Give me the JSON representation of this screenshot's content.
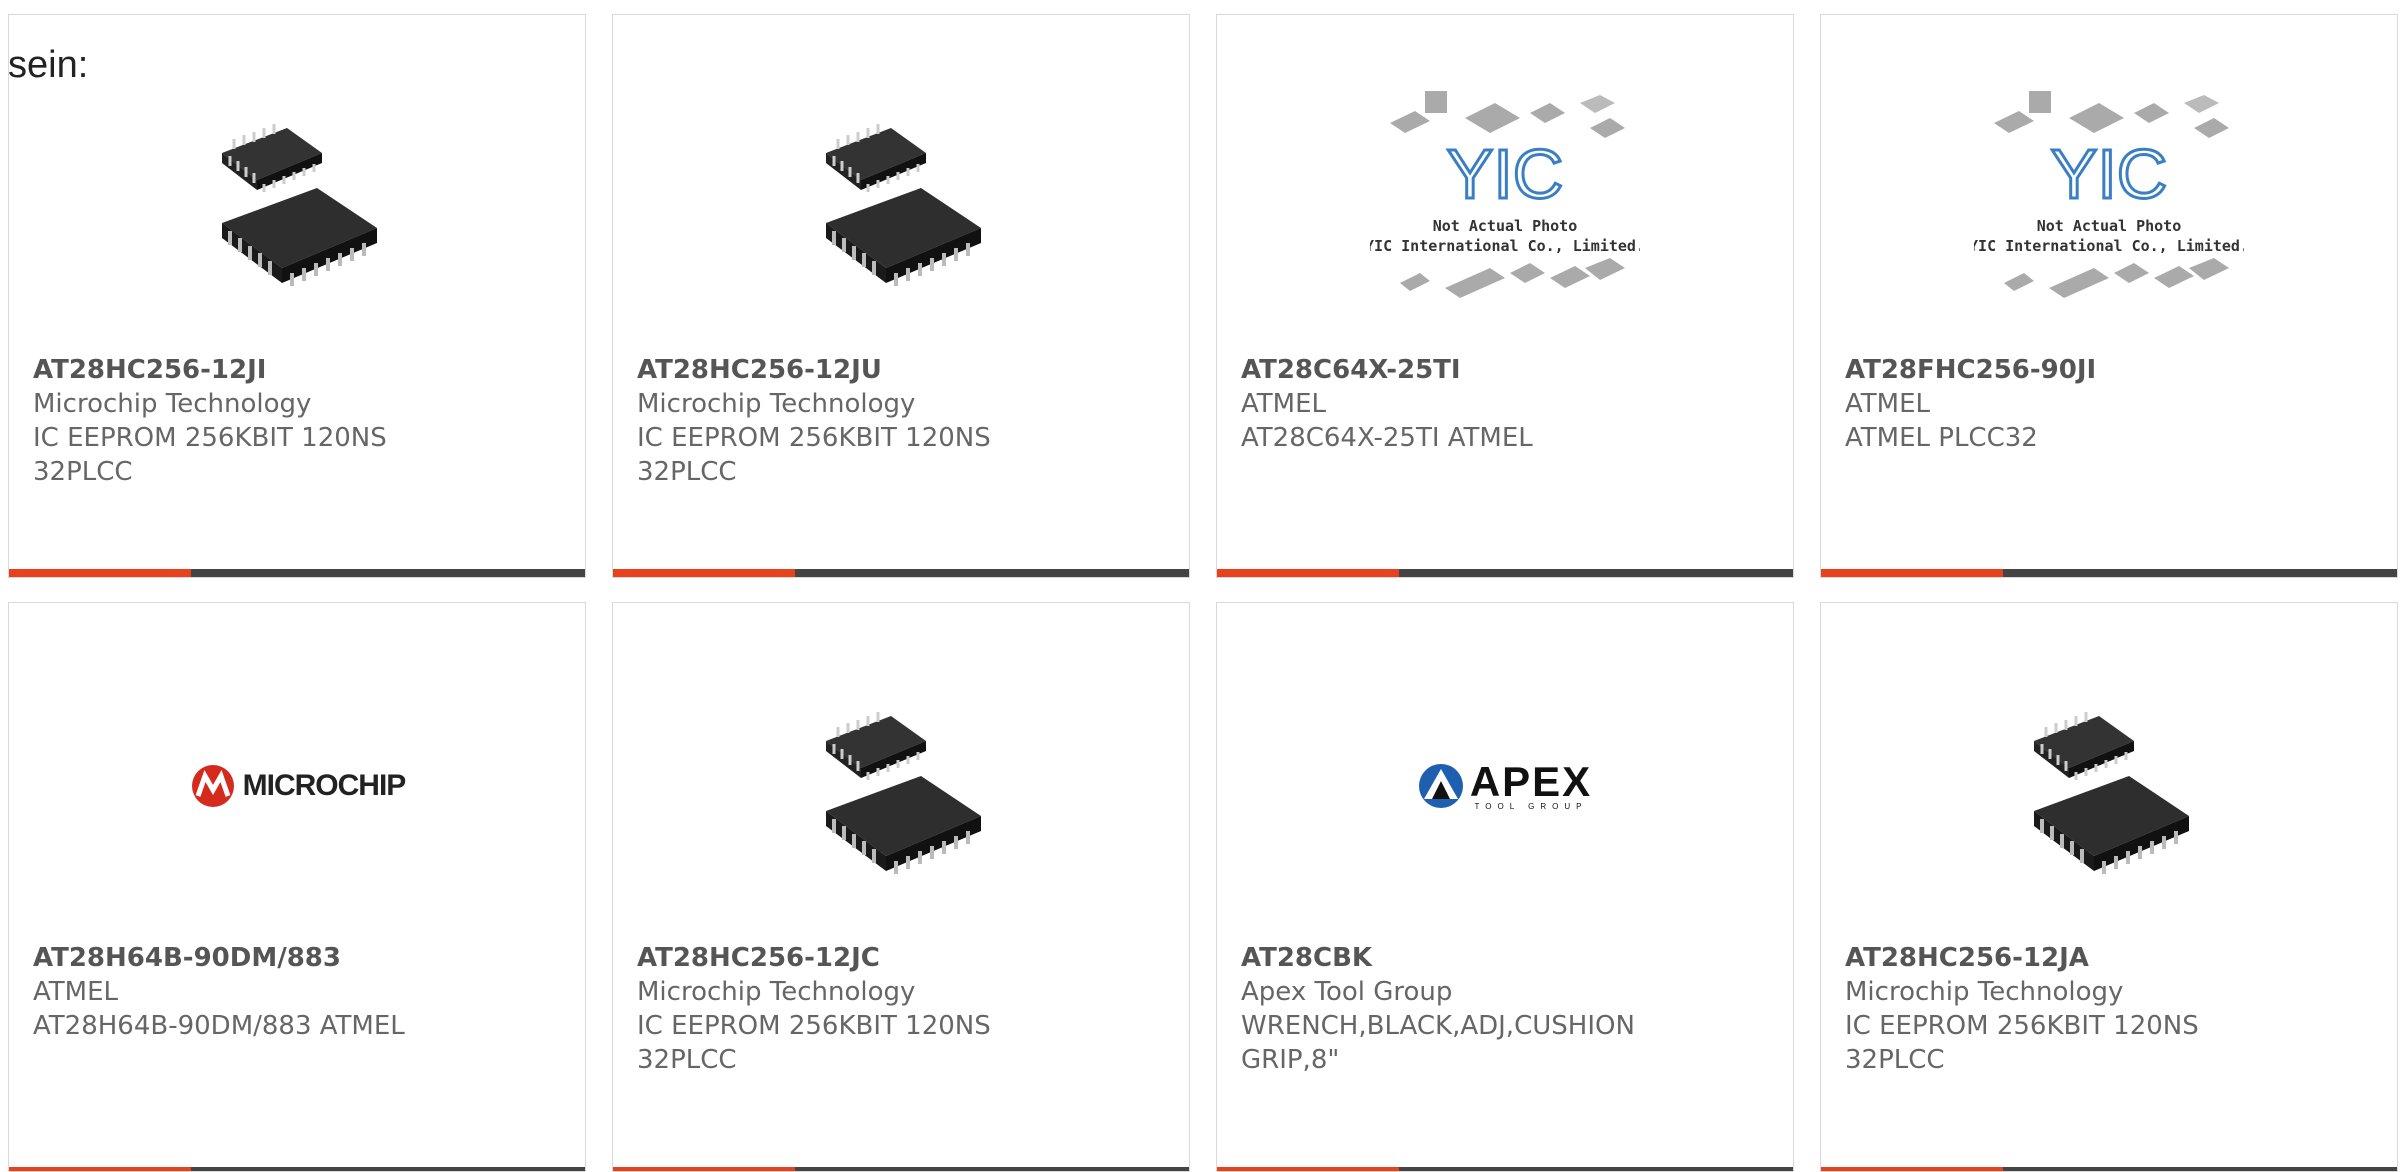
{
  "intro_text": "sein:",
  "products": [
    {
      "part": "AT28HC256-12JI",
      "maker": "Microchip Technology",
      "desc": "IC EEPROM 256KBIT 120NS 32PLCC",
      "image": "plcc-chip"
    },
    {
      "part": "AT28HC256-12JU",
      "maker": "Microchip Technology",
      "desc": "IC EEPROM 256KBIT 120NS 32PLCC",
      "image": "plcc-chip"
    },
    {
      "part": "AT28C64X-25TI",
      "maker": "ATMEL",
      "desc": "AT28C64X-25TI ATMEL",
      "image": "yic-placeholder",
      "placeholder_lines": [
        "Not Actual Photo",
        "YIC International Co., Limited."
      ],
      "logo": "YIC"
    },
    {
      "part": "AT28FHC256-90JI",
      "maker": "ATMEL",
      "desc": "ATMEL PLCC32",
      "image": "yic-placeholder",
      "placeholder_lines": [
        "Not Actual Photo",
        "YIC International Co., Limited."
      ],
      "logo": "YIC"
    },
    {
      "part": "AT28H64B-90DM/883",
      "maker": "ATMEL",
      "desc": "AT28H64B-90DM/883 ATMEL",
      "image": "microchip-logo",
      "logo": "MICROCHIP"
    },
    {
      "part": "AT28HC256-12JC",
      "maker": "Microchip Technology",
      "desc": "IC EEPROM 256KBIT 120NS 32PLCC",
      "image": "plcc-chip"
    },
    {
      "part": "AT28CBK",
      "maker": "Apex Tool Group",
      "desc": "WRENCH,BLACK,ADJ,CUSHION GRIP,8\"",
      "image": "apex-logo",
      "logo": "APEX",
      "logo_sub": "TOOL GROUP"
    },
    {
      "part": "AT28HC256-12JA",
      "maker": "Microchip Technology",
      "desc": "IC EEPROM 256KBIT 120NS 32PLCC",
      "image": "plcc-chip"
    }
  ],
  "colors": {
    "accent": "#e8421c",
    "bar": "#444444",
    "border": "#d9d9d9"
  }
}
